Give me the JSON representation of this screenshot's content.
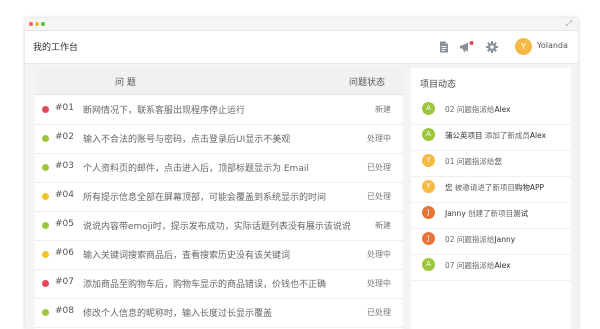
{
  "colors": {
    "accent_yellow": "#f5b945",
    "red": "#e8465b",
    "green": "#9cc63b",
    "yellow": "#f3c524",
    "orange": "#e9743a"
  },
  "titlebar": {
    "dots": [
      "#fc5b57",
      "#e5bf3c",
      "#57c038"
    ],
    "expand_icon": "⤢"
  },
  "header": {
    "page_title": "我的工作台",
    "icons": [
      "document-icon",
      "megaphone-icon",
      "gear-icon"
    ],
    "user": {
      "avatar_letter": "Y",
      "name": "Yolanda"
    }
  },
  "issues": {
    "col_issue": "问  题",
    "col_status": "问题状态",
    "rows": [
      {
        "num": "#01",
        "text": "断网情况下，联系客服出现程序停止运行",
        "status": "新建",
        "color": "#e8465b"
      },
      {
        "num": "#02",
        "text": "输入不合法的账号与密码，点击登录后UI显示不美观",
        "status": "处理中",
        "color": "#9cc63b"
      },
      {
        "num": "#03",
        "text": "个人资料页的邮件，点击进入后，顶部标题显示为 Email",
        "status": "已处理",
        "color": "#9cc63b"
      },
      {
        "num": "#04",
        "text": "所有提示信息全部在屏幕顶部，可能会覆盖到系统显示的时间",
        "status": "已处理",
        "color": "#f3c524"
      },
      {
        "num": "#05",
        "text": "说说内容带emoji时，提示发布成功，实际话题列表没有展示该说说",
        "status": "新建",
        "color": "#9cc63b"
      },
      {
        "num": "#06",
        "text": "输入关键词搜索商品后，查看搜索历史没有该关键词",
        "status": "处理中",
        "color": "#f3c524"
      },
      {
        "num": "#07",
        "text": "添加商品至购物车后，购物车显示的商品错误，价钱也不正确",
        "status": "处理中",
        "color": "#e8465b"
      },
      {
        "num": "#08",
        "text": "修改个人信息的昵称时，输入长度过长显示覆盖",
        "status": "已处理",
        "color": "#9cc63b"
      }
    ]
  },
  "activity": {
    "title": "项目动态",
    "items": [
      {
        "avatar": "A",
        "color": "#9cc63b",
        "name": "",
        "action": "02 问题指派给",
        "target": "Alex"
      },
      {
        "avatar": "A",
        "color": "#9cc63b",
        "name": "蒲公英项目",
        "action": " 添加了新成员",
        "target": "Alex"
      },
      {
        "avatar": "Y",
        "color": "#f5b945",
        "name": "",
        "action": "01 问题指派给",
        "target": "您"
      },
      {
        "avatar": "Y",
        "color": "#f5b945",
        "name": "您",
        "action": " 被邀请进了新项目",
        "target": "购物APP"
      },
      {
        "avatar": "J",
        "color": "#e9743a",
        "name": "Janny",
        "action": " 创建了新项目",
        "target": "测试"
      },
      {
        "avatar": "J",
        "color": "#e9743a",
        "name": "",
        "action": "02 问题指派给",
        "target": "Janny"
      },
      {
        "avatar": "A",
        "color": "#9cc63b",
        "name": "",
        "action": "07 问题指派给",
        "target": "Alex"
      }
    ]
  }
}
